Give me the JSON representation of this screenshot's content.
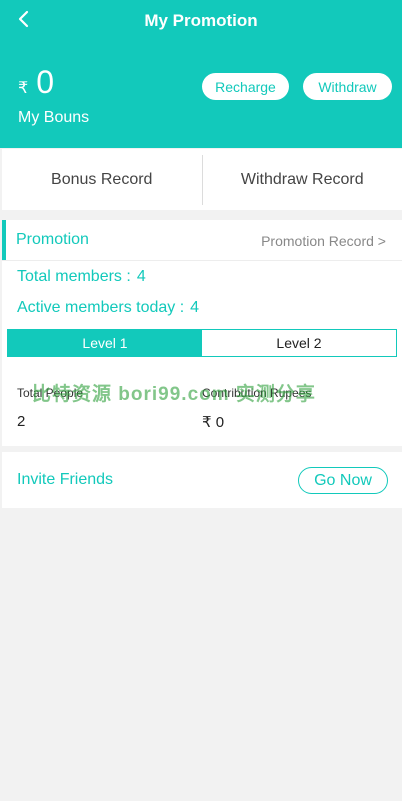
{
  "header": {
    "title": "My Promotion",
    "currency_symbol": "₹",
    "balance": "0",
    "balance_label": "My Bouns",
    "recharge_label": "Recharge",
    "withdraw_label": "Withdraw",
    "accent_color": "#12c9bb"
  },
  "record_tabs": [
    {
      "label": "Bonus Record"
    },
    {
      "label": "Withdraw Record"
    }
  ],
  "promotion": {
    "title": "Promotion",
    "record_link": "Promotion Record >",
    "total_members_label": "Total members :",
    "total_members_value": "4",
    "active_today_label": "Active members today :",
    "active_today_value": "4",
    "levels": [
      {
        "label": "Level 1",
        "active": true
      },
      {
        "label": "Level 2",
        "active": false
      }
    ],
    "table": {
      "col1_label": "Total People",
      "col1_value": "2",
      "col2_label": "Contribution Rupees",
      "col2_value": "₹ 0"
    }
  },
  "watermark": "比特资源 bori99.com 实测分享",
  "invite": {
    "label": "Invite Friends",
    "button": "Go Now"
  },
  "icons": {
    "back": "chevron-left-icon"
  }
}
